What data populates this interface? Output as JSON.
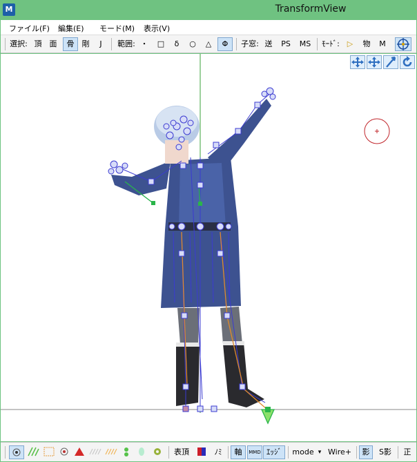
{
  "window": {
    "title": "TransformView"
  },
  "menu": [
    {
      "label": "ファイル(F)"
    },
    {
      "label": "編集(E)"
    },
    {
      "label": "モード(M)"
    },
    {
      "label": "表示(V)"
    }
  ],
  "toolbar": {
    "select_label": "選択:",
    "vertex": "頂",
    "face": "面",
    "bone": "骨",
    "rigid": "剛",
    "joint": "J",
    "range_label": "範囲:",
    "range_dot": "・",
    "range_square": "□",
    "range_delta": "δ",
    "range_circle": "○",
    "range_triangle": "△",
    "range_phi": "Φ",
    "child_window_label": "子窓:",
    "send": "送",
    "ps": "PS",
    "ms": "MS",
    "mode_label": "ﾓｰﾄﾞ:",
    "play_icon": "▷",
    "physics": "物",
    "m": "M"
  },
  "bottom": {
    "surface_vertex": "表頂",
    "no": "ﾉﾐ",
    "axis": "軸",
    "mmd": "MMD",
    "edge": "ｴｯｼﾞ",
    "mode": "mode",
    "mode_caret": "▾",
    "wire": "Wire+",
    "shadow": "影",
    "sshadow": "S影",
    "front": "正"
  },
  "colors": {
    "titlebar": "#6fc281",
    "pressed": "#cde3f7",
    "bone_blue": "#3b3bd1",
    "ik_orange": "#e08a2e",
    "selected_green": "#2ab54a",
    "ground_line": "#8a8a8a",
    "y_axis": "#3aa13a",
    "camera_red": "#c0242a"
  }
}
